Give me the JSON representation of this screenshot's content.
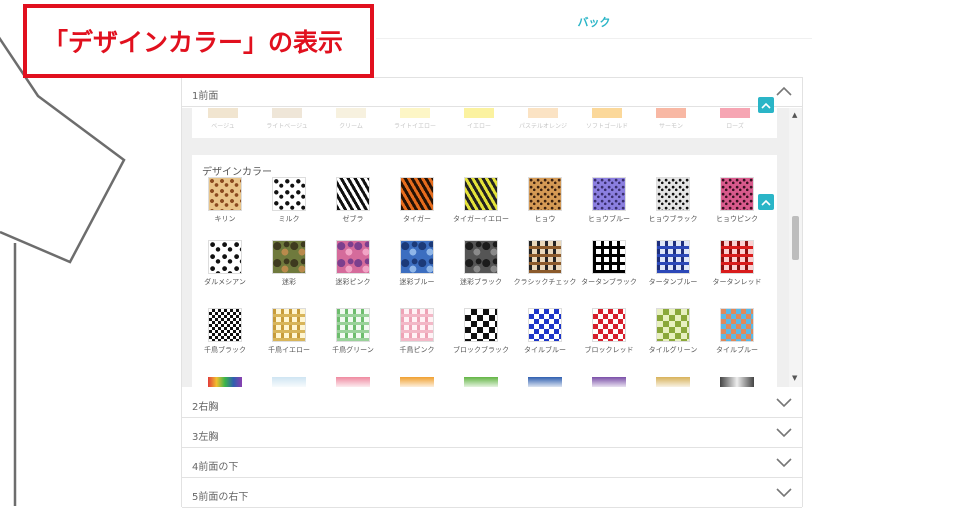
{
  "caption": "「デザインカラー」の表示",
  "tabs": {
    "back": "バック"
  },
  "accordion": [
    {
      "label": "1前面",
      "expanded": true
    },
    {
      "label": "2右胸",
      "expanded": false
    },
    {
      "label": "3左胸",
      "expanded": false
    },
    {
      "label": "4前面の下",
      "expanded": false
    },
    {
      "label": "5前面の右下",
      "expanded": false
    }
  ],
  "plain_colors": {
    "labels": [
      "ベージュ",
      "ライトベージュ",
      "クリーム",
      "ライトイエロー",
      "イエロー",
      "パステルオレンジ",
      "ソフトゴールド",
      "サーモン",
      "ローズ"
    ],
    "colors": [
      "#f1e5d0",
      "#efe6d8",
      "#f7f1df",
      "#fdf6c6",
      "#fbf2a0",
      "#fbe3c4",
      "#fbd89a",
      "#f8b8a4",
      "#f6a5b3"
    ]
  },
  "design_colors": {
    "title": "デザインカラー",
    "items": [
      {
        "label": "キリン",
        "pattern": "giraffe"
      },
      {
        "label": "ミルク",
        "pattern": "milk"
      },
      {
        "label": "ゼブラ",
        "pattern": "zebra"
      },
      {
        "label": "タイガー",
        "pattern": "tiger"
      },
      {
        "label": "タイガーイエロー",
        "pattern": "tiger-yellow"
      },
      {
        "label": "ヒョウ",
        "pattern": "leopard"
      },
      {
        "label": "ヒョウブルー",
        "pattern": "leopard-blue"
      },
      {
        "label": "ヒョウブラック",
        "pattern": "leopard-black"
      },
      {
        "label": "ヒョウピンク",
        "pattern": "leopard-pink"
      },
      {
        "label": "ダルメシアン",
        "pattern": "dalmatian"
      },
      {
        "label": "迷彩",
        "pattern": "camo"
      },
      {
        "label": "迷彩ピンク",
        "pattern": "camo-pink"
      },
      {
        "label": "迷彩ブルー",
        "pattern": "camo-blue"
      },
      {
        "label": "迷彩ブラック",
        "pattern": "camo-black"
      },
      {
        "label": "クラシックチェック",
        "pattern": "check-classic"
      },
      {
        "label": "タータンブラック",
        "pattern": "tartan-black"
      },
      {
        "label": "タータンブルー",
        "pattern": "tartan-blue"
      },
      {
        "label": "タータンレッド",
        "pattern": "tartan-red"
      },
      {
        "label": "千鳥ブラック",
        "pattern": "houndstooth-black"
      },
      {
        "label": "千鳥イエロー",
        "pattern": "houndstooth-yellow"
      },
      {
        "label": "千鳥グリーン",
        "pattern": "houndstooth-green"
      },
      {
        "label": "千鳥ピンク",
        "pattern": "houndstooth-pink"
      },
      {
        "label": "ブロックブラック",
        "pattern": "block-black"
      },
      {
        "label": "タイルブルー",
        "pattern": "tile-blue"
      },
      {
        "label": "ブロックレッド",
        "pattern": "block-red"
      },
      {
        "label": "タイルグリーン",
        "pattern": "tile-green"
      },
      {
        "label": "タイルブルー",
        "pattern": "tile-multi"
      }
    ],
    "partial_row_colors": [
      "#e23a3a",
      "#cfe5f2",
      "#ef8aa0",
      "#f0a030",
      "#62b544",
      "#2f5fb0",
      "#7b4fa8",
      "#d8b25a",
      "#8a8a8a"
    ]
  }
}
